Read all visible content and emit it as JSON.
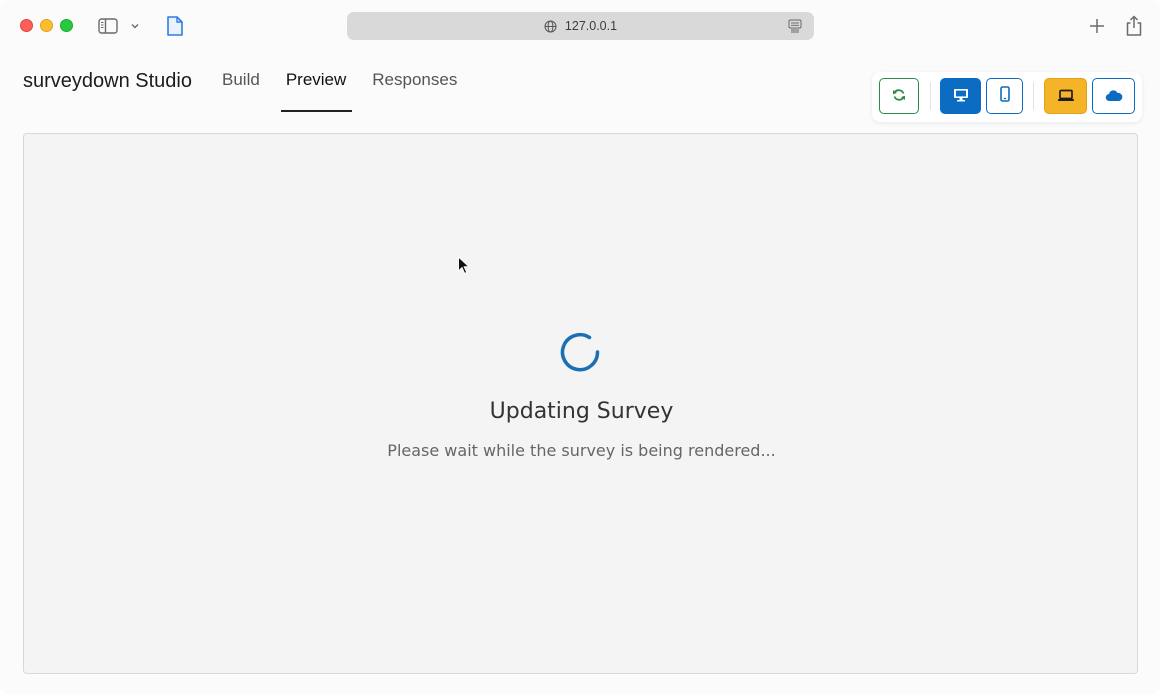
{
  "browser": {
    "url": "127.0.0.1",
    "icons": {
      "sidebar": "sidebar-icon",
      "chevron": "chevron-down-icon",
      "page": "document-icon",
      "globe": "globe-icon",
      "reader": "reader-mode-icon",
      "new_tab": "plus-icon",
      "share": "share-icon"
    }
  },
  "app": {
    "title": "surveydown Studio",
    "tabs": [
      {
        "label": "Build",
        "active": false
      },
      {
        "label": "Preview",
        "active": true
      },
      {
        "label": "Responses",
        "active": false
      }
    ]
  },
  "toolbar": {
    "buttons": [
      {
        "name": "refresh-button",
        "icon": "refresh-icon",
        "color": "#2e8b47"
      },
      {
        "name": "desktop-view-button",
        "icon": "desktop-icon",
        "color": "#0b6cc1",
        "active": true
      },
      {
        "name": "mobile-view-button",
        "icon": "mobile-icon",
        "color": "#0b6cc1"
      },
      {
        "name": "local-mode-button",
        "icon": "laptop-icon",
        "color": "#f5b427",
        "active": true
      },
      {
        "name": "cloud-mode-button",
        "icon": "cloud-icon",
        "color": "#0b6cc1"
      }
    ]
  },
  "preview": {
    "loading_title": "Updating Survey",
    "loading_message": "Please wait while the survey is being rendered...",
    "spinner_color": "#1a6fb5"
  }
}
